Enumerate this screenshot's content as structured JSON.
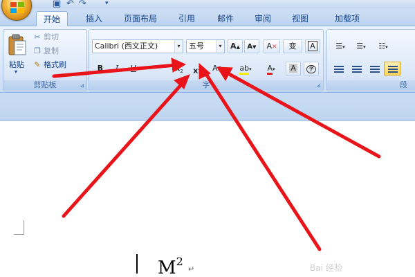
{
  "quick_access": {
    "undo_label": "↶",
    "redo_label": "↷",
    "more_label": "▾"
  },
  "tabs": [
    {
      "label": "开始",
      "active": true
    },
    {
      "label": "插入"
    },
    {
      "label": "页面布局"
    },
    {
      "label": "引用"
    },
    {
      "label": "邮件"
    },
    {
      "label": "审阅"
    },
    {
      "label": "视图"
    },
    {
      "label": "加载项"
    }
  ],
  "clipboard": {
    "group_label": "剪贴板",
    "paste_label": "粘贴",
    "cut_label": "剪切",
    "copy_label": "复制",
    "format_painter_label": "格式刷"
  },
  "font": {
    "group_label": "字",
    "font_name": "Calibri (西文正文)",
    "font_size": "五号",
    "grow_label": "A",
    "shrink_label": "A",
    "clear_label": "A",
    "phonetic_label": "变",
    "border_label": "A",
    "bold_label": "B",
    "italic_label": "I",
    "underline_label": "U",
    "subscript_label": "x",
    "superscript_label": "x",
    "change_case_label": "Aa",
    "highlight_label": "ab",
    "font_color_label": "A",
    "shading_label": "A",
    "enclose_label": "字",
    "font_color": "#e02020",
    "highlight_color": "#ffe900"
  },
  "paragraph": {
    "group_label": "段"
  },
  "document": {
    "base_text": "M",
    "superscript": "2",
    "para_mark": "↵",
    "watermark": "Bai 经验"
  },
  "colors": {
    "arrow": "#e8141a",
    "accent": "#15428b"
  }
}
